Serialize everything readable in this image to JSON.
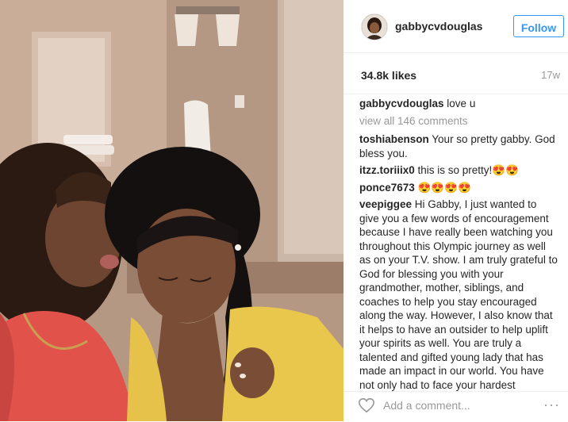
{
  "post": {
    "username": "gabbycvdouglas",
    "follow_label": "Follow",
    "likes": "34.8k likes",
    "time": "17w",
    "caption_user": "gabbycvdouglas",
    "caption_text": "love u",
    "view_all": "view all 146 comments"
  },
  "comments": [
    {
      "user": "toshiabenson",
      "text": "Your so pretty gabby. God bless you."
    },
    {
      "user": "itzz.toriiix0",
      "text": "this is so pretty!😍😍"
    },
    {
      "user": "ponce7673",
      "text": "😍😍😍😍"
    },
    {
      "user": "veepiggee",
      "text": "Hi Gabby, I just wanted to give you a few words of encouragement because I have really been watching you throughout this Olympic journey as well as on your T.V. show. I am truly grateful to God for blessing you with your grandmother, mother, siblings, and coaches to help you stay encouraged along the way. However, I also know that it helps to have an outsider to help uplift your spirits as well. You are truly a talented and gifted young lady that has made an impact in our world. You have not only had to face your hardest competition but you have also had to"
    }
  ],
  "footer": {
    "add_comment_placeholder": "Add a comment...",
    "more_label": "···"
  },
  "colors": {
    "accent": "#3897f0",
    "muted": "#999999",
    "text": "#262626"
  }
}
